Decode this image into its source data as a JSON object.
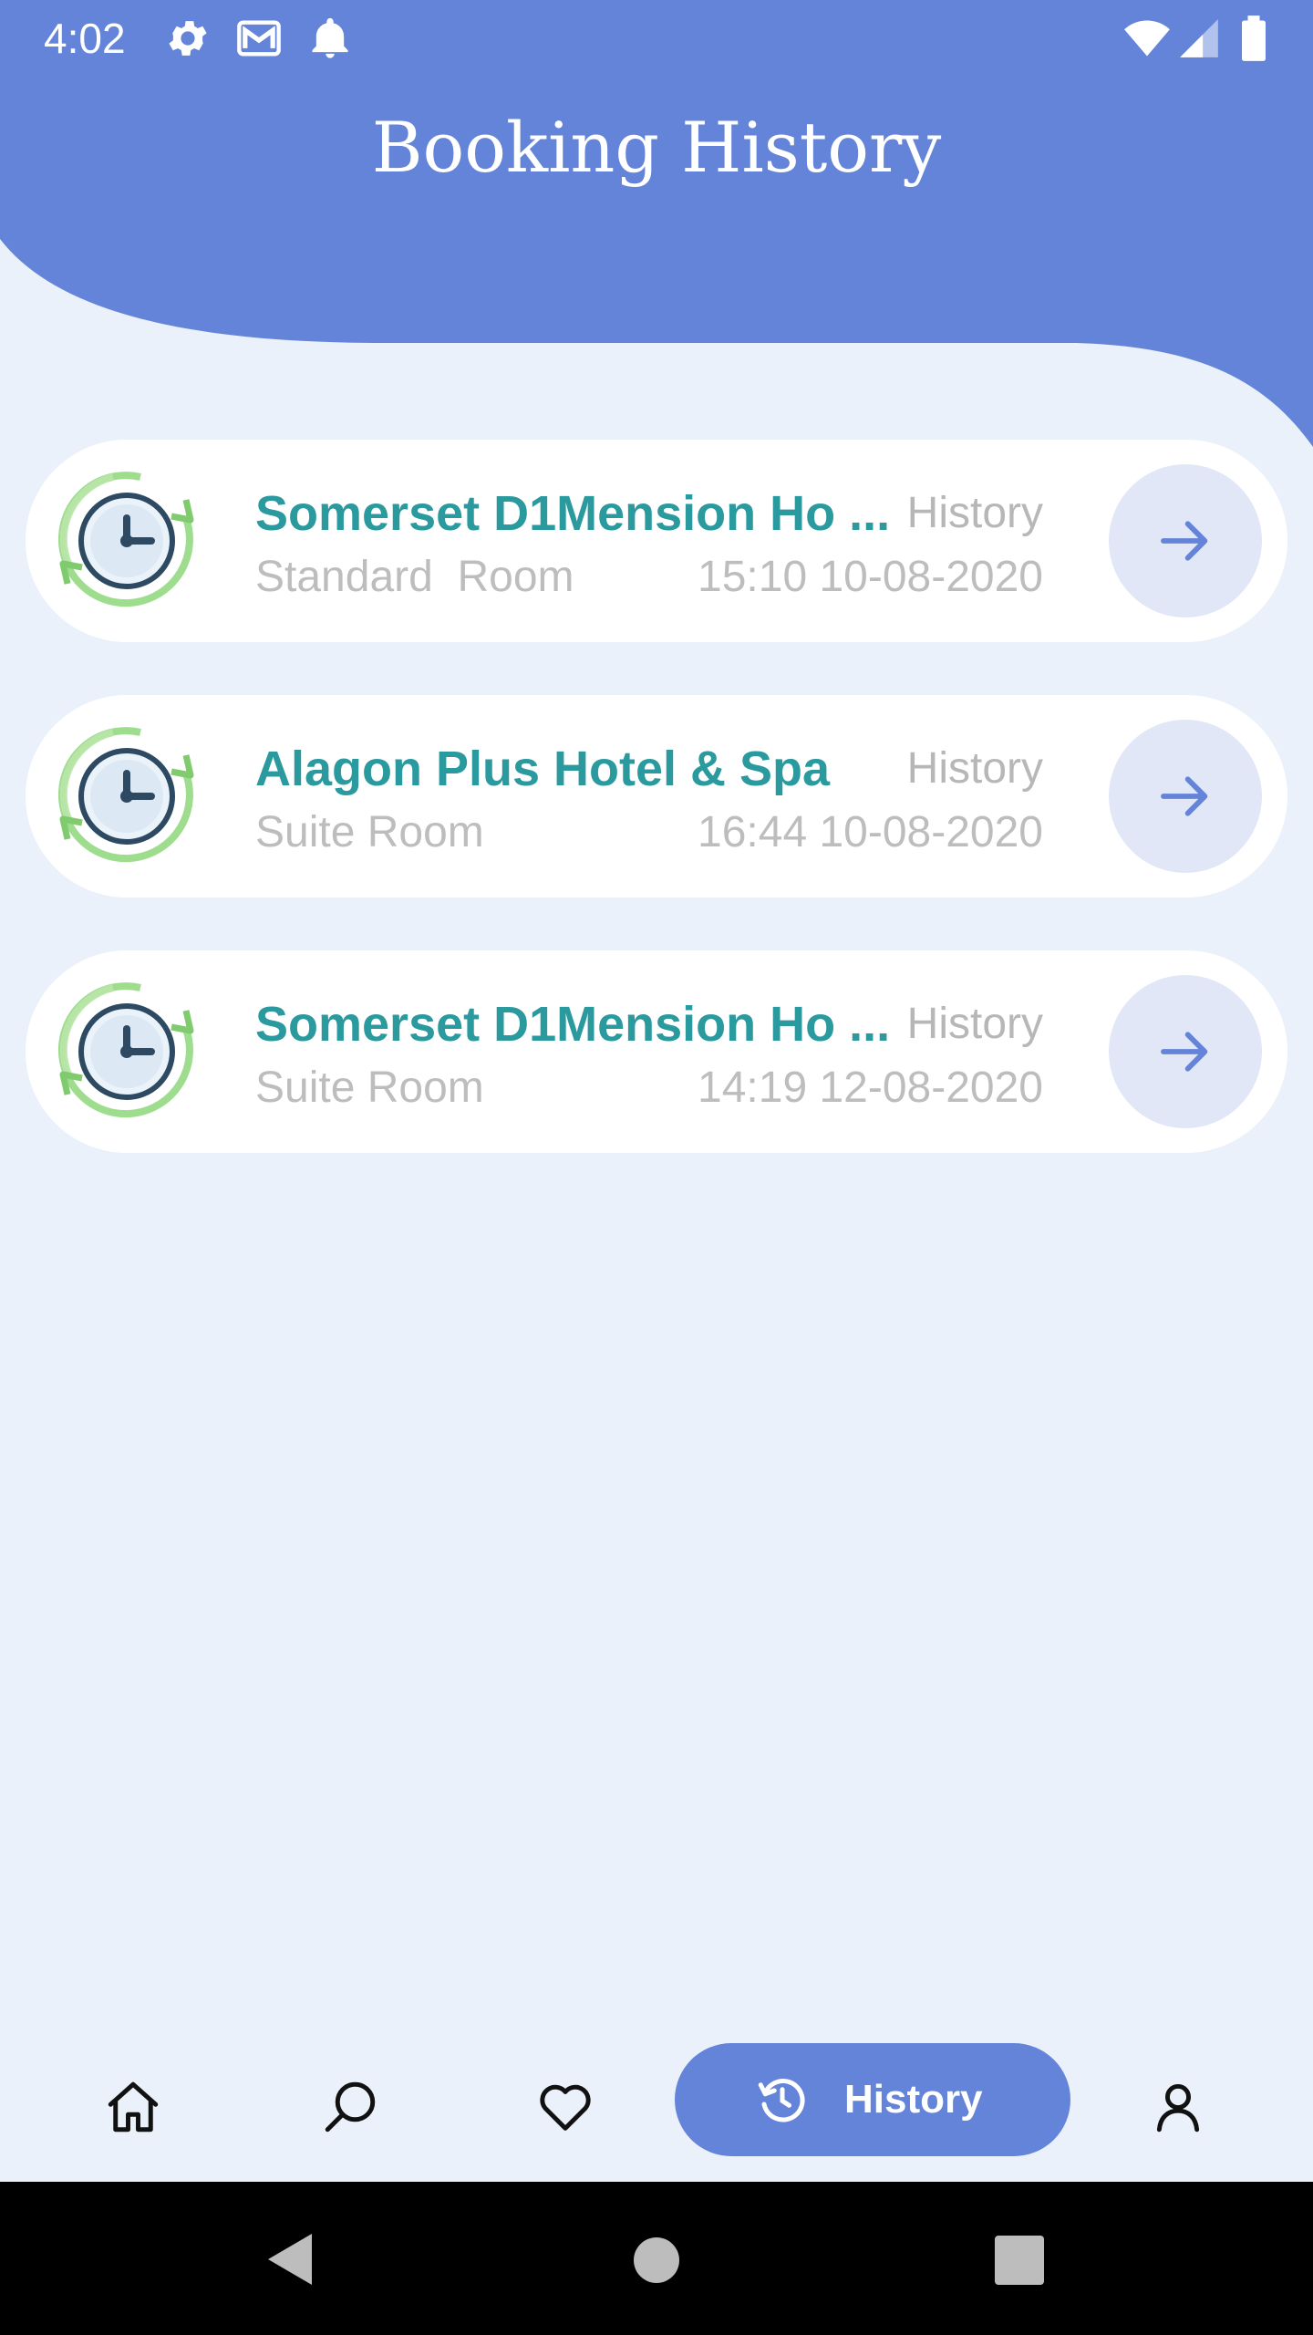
{
  "status_bar": {
    "time": "4:02",
    "icons": [
      "settings-icon",
      "gmail-icon",
      "notification-bell-icon",
      "wifi-icon",
      "signal-icon",
      "battery-icon"
    ]
  },
  "header": {
    "title": "Booking History"
  },
  "bookings": [
    {
      "hotel_name": "Somerset D1Mension Ho ...",
      "status": "History",
      "room_type": "Standard  Room",
      "datetime": "15:10 10-08-2020"
    },
    {
      "hotel_name": "Alagon Plus Hotel & Spa",
      "status": "History",
      "room_type": "Suite Room",
      "datetime": "16:44 10-08-2020"
    },
    {
      "hotel_name": "Somerset D1Mension Ho ...",
      "status": "History",
      "room_type": "Suite Room",
      "datetime": "14:19 12-08-2020"
    }
  ],
  "bottom_nav": {
    "items": [
      "home-icon",
      "search-icon",
      "heart-icon",
      "history-icon",
      "profile-icon"
    ],
    "active_label": "History"
  },
  "colors": {
    "header": "#6384D8",
    "background": "#EBF1FA",
    "hotel_name": "#2A9A9F",
    "secondary_text": "#BDBDBD",
    "arrow_button_bg": "#E1E7F7",
    "accent": "#6384D8"
  }
}
